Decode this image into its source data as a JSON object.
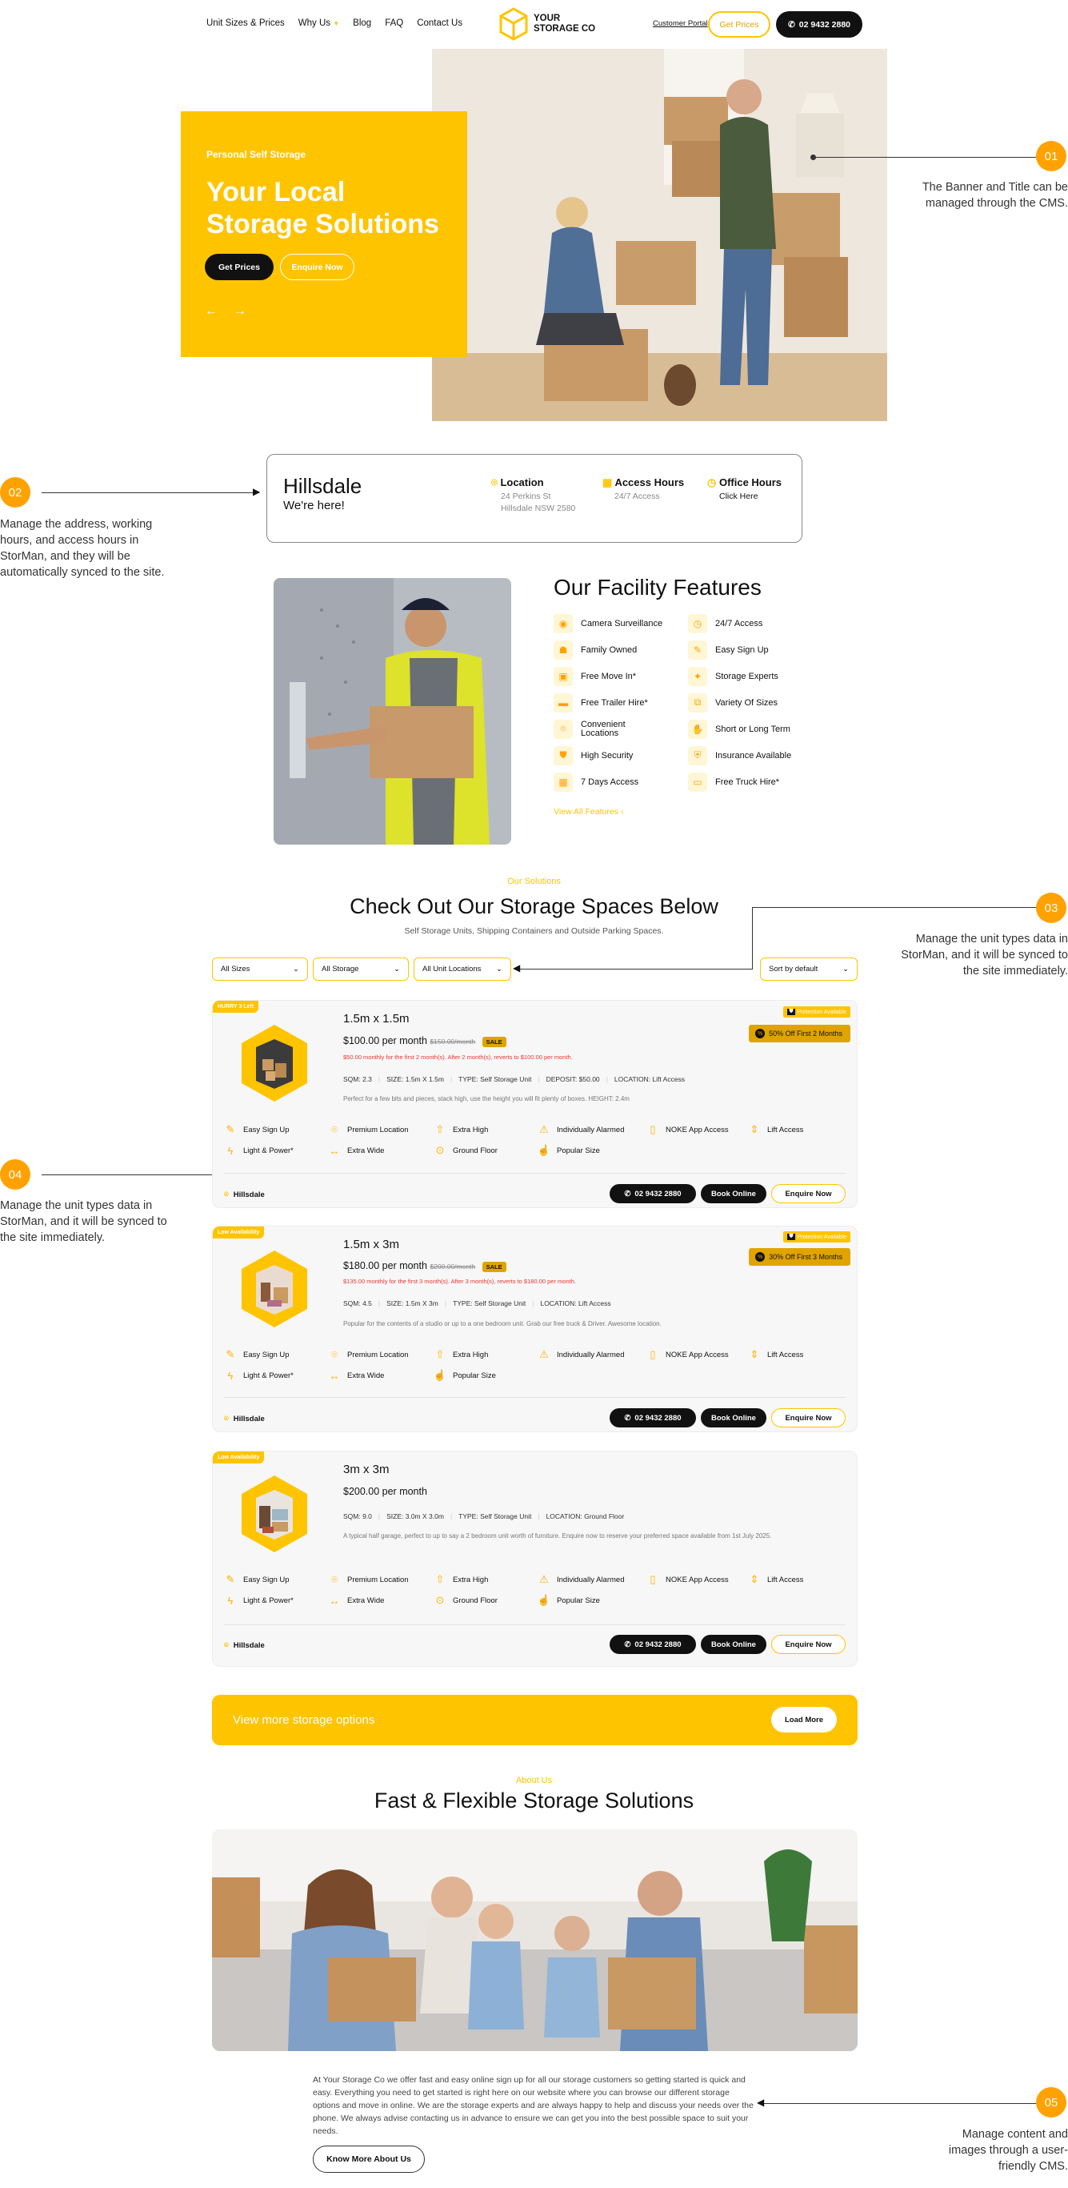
{
  "nav": {
    "links": [
      "Unit Sizes & Prices",
      "Why Us",
      "Blog",
      "FAQ",
      "Contact Us"
    ],
    "logo_line1": "YOUR",
    "logo_line2": "STORAGE CO",
    "customer_portal": "Customer Portal",
    "get_prices": "Get Prices",
    "phone": "02 9432 2880"
  },
  "hero": {
    "eyebrow": "Personal Self Storage",
    "title_line1": "Your Local",
    "title_line2": "Storage Solutions",
    "btn_primary": "Get Prices",
    "btn_secondary": "Enquire Now",
    "prev": "←",
    "next": "→"
  },
  "notes": {
    "n1": {
      "num": "01",
      "text": "The Banner and Title can be managed through the CMS."
    },
    "n2": {
      "num": "02",
      "text": "Manage the address, working hours, and access hours in StorMan, and they will be automatically synced to the site."
    },
    "n3": {
      "num": "03",
      "text": "Manage the unit types data in StorMan, and it will be synced to the site immediately."
    },
    "n4": {
      "num": "04",
      "text": "Manage the unit types data in StorMan, and it will be synced to the site immediately."
    },
    "n5": {
      "num": "05",
      "text": "Manage content and images through a user-friendly CMS."
    }
  },
  "location": {
    "name": "Hillsdale",
    "tagline": "We're here!",
    "location_label": "Location",
    "address1": "24 Perkins St",
    "address2": "Hillsdale NSW 2580",
    "access_label": "Access Hours",
    "access_value": "24/7 Access",
    "office_label": "Office Hours",
    "office_value": "Click Here"
  },
  "facility": {
    "title": "Our Facility Features",
    "left": [
      "Camera Surveillance",
      "Family Owned",
      "Free Move In*",
      "Free Trailer Hire*",
      "Convenient Locations",
      "High Security",
      "7 Days Access"
    ],
    "right": [
      "24/7 Access",
      "Easy Sign Up",
      "Storage Experts",
      "Variety Of Sizes",
      "Short or Long Term",
      "Insurance Available",
      "Free Truck Hire*"
    ],
    "view_all": "View All Features"
  },
  "solutions": {
    "eyebrow": "Our Solutions",
    "title": "Check Out Our Storage Spaces Below",
    "subtitle": "Self Storage Units, Shipping Containers and Outside Parking Spaces.",
    "filters": [
      "All Sizes",
      "All Storage",
      "All Unit Locations"
    ],
    "sort": "Sort by default"
  },
  "units": [
    {
      "tag": "HURRY 3 Left",
      "size": "1.5m x 1.5m",
      "price": "$100.00 per month",
      "old_price": "$150.00/month",
      "sale": "SALE",
      "promo": "$50.00 monthly for the first 2 month(s). After 2 month(s), reverts to $100.00 per month.",
      "protection": "Protection Available",
      "offer": "50% Off First 2 Months",
      "specs": [
        "SQM: 2.3",
        "SIZE: 1.5m X 1.5m",
        "TYPE: Self Storage Unit",
        "DEPOSIT: $50.00",
        "LOCATION: Lift Access"
      ],
      "desc": "Perfect for a few bits and pieces, stack high, use the height you will fit plenty of boxes. HEIGHT: 2.4m",
      "amenities": [
        "Easy Sign Up",
        "Premium Location",
        "Extra High",
        "Individually Alarmed",
        "NOKE App Access",
        "Lift Access",
        "Light & Power*",
        "Extra Wide",
        "Ground Floor",
        "Popular Size"
      ],
      "location": "Hillsdale",
      "phone": "02 9432 2880",
      "book": "Book Online",
      "enquire": "Enquire Now"
    },
    {
      "tag": "Low Availability",
      "size": "1.5m x 3m",
      "price": "$180.00 per month",
      "old_price": "$200.00/month",
      "sale": "SALE",
      "promo": "$135.00 monthly for the first 3 month(s). After 3 month(s), reverts to $180.00 per month.",
      "protection": "Protection Available",
      "offer": "30% Off First 3 Months",
      "specs": [
        "SQM: 4.5",
        "SIZE: 1.5m X 3m",
        "TYPE: Self Storage Unit",
        "LOCATION: Lift Access"
      ],
      "desc": "Popular for the contents of a studio or up to a one bedroom unit. Grab our free truck & Driver. Awesome location.",
      "amenities": [
        "Easy Sign Up",
        "Premium Location",
        "Extra High",
        "Individually Alarmed",
        "NOKE App Access",
        "Lift Access",
        "Light & Power*",
        "Extra Wide",
        "Popular Size"
      ],
      "location": "Hillsdale",
      "phone": "02 9432 2880",
      "book": "Book Online",
      "enquire": "Enquire Now"
    },
    {
      "tag": "Low Availability",
      "size": "3m x 3m",
      "price": "$200.00 per month",
      "specs": [
        "SQM: 9.0",
        "SIZE: 3.0m X 3.0m",
        "TYPE: Self Storage Unit",
        "LOCATION: Ground Floor"
      ],
      "desc": "A typical half garage, perfect to up to say a 2 bedroom unit worth of furniture. Enquire now to reserve your preferred space available from 1st July 2025.",
      "amenities": [
        "Easy Sign Up",
        "Premium Location",
        "Extra High",
        "Individually Alarmed",
        "NOKE App Access",
        "Lift Access",
        "Light & Power*",
        "Extra Wide",
        "Ground Floor",
        "Popular Size"
      ],
      "location": "Hillsdale",
      "phone": "02 9432 2880",
      "book": "Book Online",
      "enquire": "Enquire Now"
    }
  ],
  "more": {
    "text": "View more storage options",
    "button": "Load More"
  },
  "about": {
    "eyebrow": "About Us",
    "title": "Fast & Flexible Storage Solutions",
    "body": "At Your Storage Co we offer fast and easy online sign up for all our storage customers so getting started is quick and easy. Everything you need to get started is right here on our website where you can browse our different storage options and move in online. We are the storage experts and are always happy to help and discuss your needs over the phone. We always advise contacting us in advance to ensure we can get you into the best possible space to suit your needs.",
    "button": "Know More About Us"
  },
  "colors": {
    "accent": "#FFC400",
    "badge": "#FFA200",
    "sale": "#E0A400"
  }
}
